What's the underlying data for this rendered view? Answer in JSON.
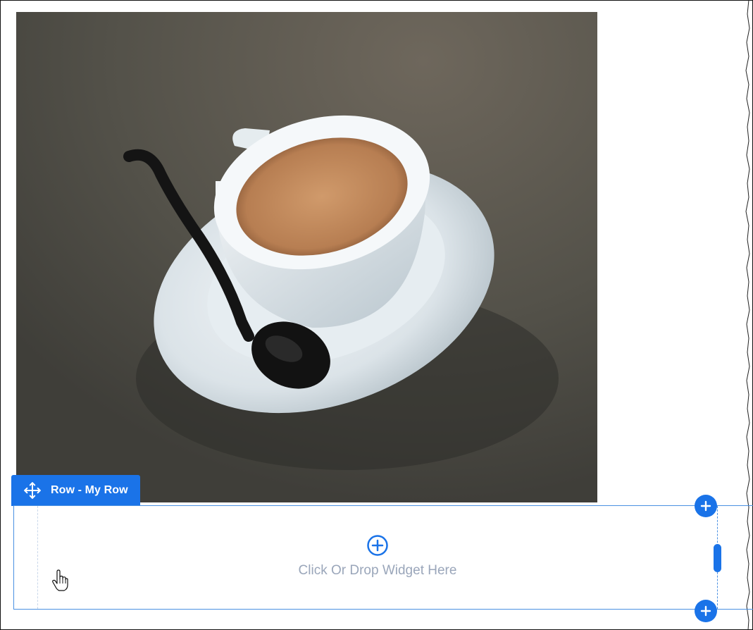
{
  "row": {
    "tab_label": "Row - My Row",
    "drop_zone_text": "Click Or Drop Widget Here"
  },
  "image": {
    "subject": "espresso-cup-on-saucer-with-spoon"
  },
  "colors": {
    "accent": "#1a73e8",
    "drop_text": "#9aa6ba",
    "border": "#4a90e2"
  },
  "icons": {
    "move": "move-icon",
    "add_widget": "add-widget-icon",
    "add_row_top": "plus-icon",
    "add_row_bottom": "plus-icon",
    "cursor": "hand-pointer-icon"
  }
}
